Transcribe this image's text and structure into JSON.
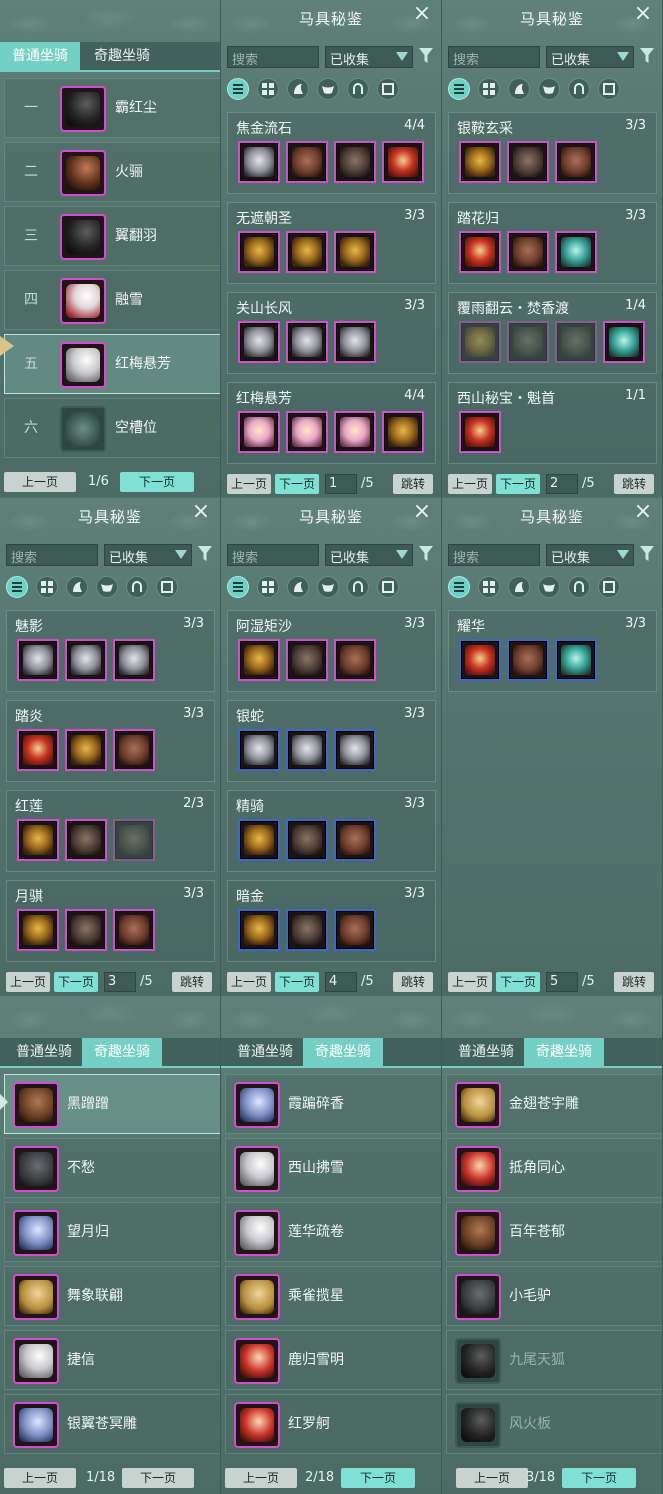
{
  "p1": {
    "tabs": [
      "普通坐骑",
      "奇趣坐骑"
    ],
    "rows": [
      {
        "idx": "一",
        "name": "霸红尘"
      },
      {
        "idx": "二",
        "name": "火骊"
      },
      {
        "idx": "三",
        "name": "翼翻羽"
      },
      {
        "idx": "四",
        "name": "融雪"
      },
      {
        "idx": "五",
        "name": "红梅悬芳"
      },
      {
        "idx": "六",
        "name": "空槽位"
      }
    ],
    "prev": "上一页",
    "page": "1/6",
    "next": "下一页"
  },
  "codex": {
    "title": "马具秘鉴",
    "search_placeholder": "搜索",
    "filter": "已收集",
    "prev": "上一页",
    "next": "下一页",
    "jump": "跳转",
    "total": "/5"
  },
  "p2": {
    "page": "1",
    "sets": [
      {
        "name": "焦金流石",
        "count": "4/4"
      },
      {
        "name": "无遮朝圣",
        "count": "3/3"
      },
      {
        "name": "关山长风",
        "count": "3/3"
      },
      {
        "name": "红梅悬芳",
        "count": "4/4"
      }
    ]
  },
  "p3": {
    "page": "2",
    "sets": [
      {
        "name": "银鞍玄采",
        "count": "3/3"
      },
      {
        "name": "踏花归",
        "count": "3/3"
      },
      {
        "name": "覆雨翻云・焚香渡",
        "count": "1/4"
      },
      {
        "name": "西山秘宝・魁首",
        "count": "1/1"
      }
    ]
  },
  "p4": {
    "page": "3",
    "sets": [
      {
        "name": "魅影",
        "count": "3/3"
      },
      {
        "name": "踏炎",
        "count": "3/3"
      },
      {
        "name": "红莲",
        "count": "2/3"
      },
      {
        "name": "月骐",
        "count": "3/3"
      }
    ]
  },
  "p5": {
    "page": "4",
    "sets": [
      {
        "name": "阿湿矩沙",
        "count": "3/3"
      },
      {
        "name": "银蛇",
        "count": "3/3"
      },
      {
        "name": "精骑",
        "count": "3/3"
      },
      {
        "name": "暗金",
        "count": "3/3"
      }
    ]
  },
  "p6": {
    "page": "5",
    "sets": [
      {
        "name": "耀华",
        "count": "3/3"
      }
    ]
  },
  "fun": {
    "tabs": [
      "普通坐骑",
      "奇趣坐骑"
    ],
    "prev": "上一页",
    "next": "下一页",
    "p7": {
      "page": "1/18",
      "names": [
        "黑蹭蹭",
        "不愁",
        "望月归",
        "舞象联翩",
        "捷信",
        "银翼苍冥雕"
      ]
    },
    "p8": {
      "page": "2/18",
      "names": [
        "霞蹁碎香",
        "西山拂雪",
        "莲华疏卷",
        "乘雀揽星",
        "鹿归雪明",
        "红罗舸"
      ]
    },
    "p9": {
      "page": "3/18",
      "names": [
        "金翅苍宇雕",
        "抵角同心",
        "百年苍郁",
        "小毛驴",
        "九尾天狐",
        "风火板"
      ]
    }
  },
  "colors": {
    "accent": "#74cfc4",
    "item_border_purple": "#d44ccf",
    "item_border_blue": "#3d68c8"
  }
}
